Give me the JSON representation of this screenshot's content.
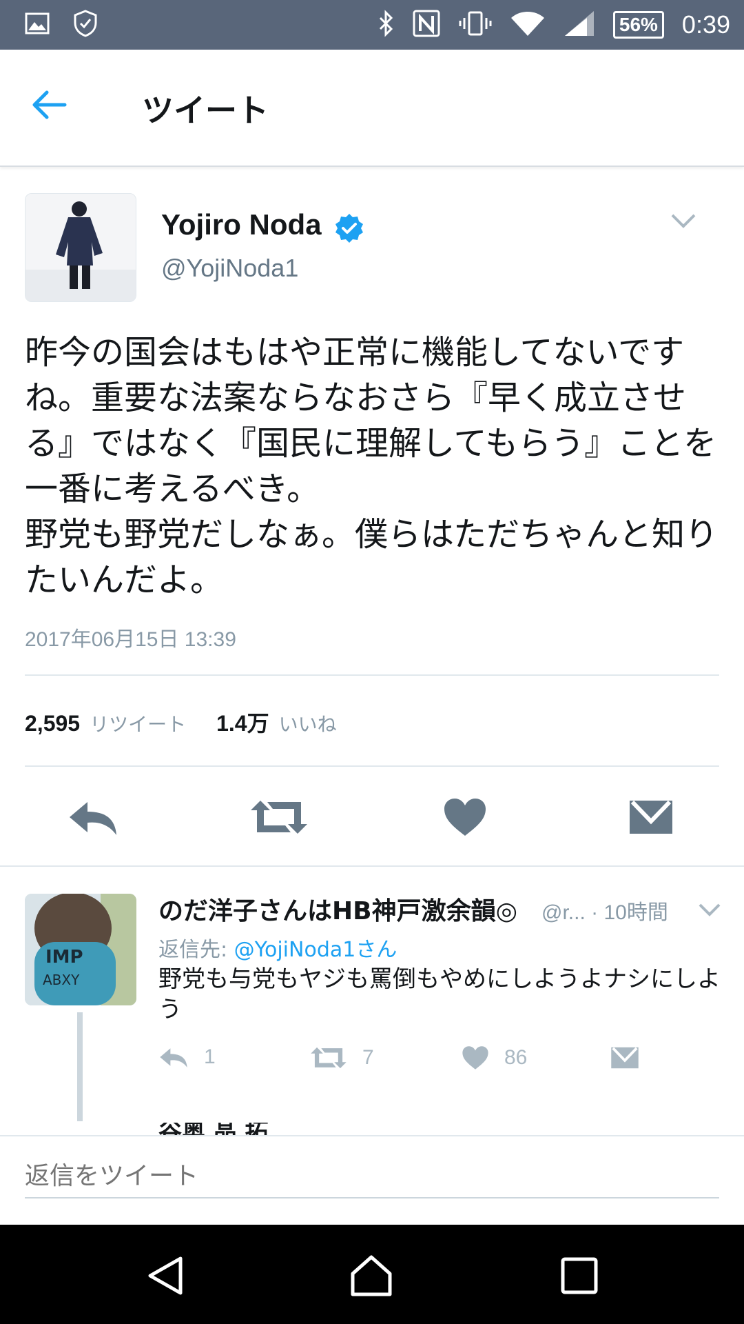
{
  "status_bar": {
    "battery": "56%",
    "time": "0:39",
    "icons": [
      "image-icon",
      "shield-icon",
      "bluetooth-icon",
      "nfc-icon",
      "vibrate-icon",
      "wifi-icon",
      "signal-icon"
    ]
  },
  "header": {
    "title": "ツイート"
  },
  "tweet": {
    "author_name": "Yojiro Noda",
    "author_handle": "@YojiNoda1",
    "text": "昨今の国会はもはや正常に機能してないですね。重要な法案ならなおさら『早く成立させる』ではなく『国民に理解してもらう』ことを一番に考えるべき。\n野党も野党だしなぁ。僕らはただちゃんと知りたいんだよ。",
    "timestamp": "2017年06月15日 13:39",
    "retweets_count": "2,595",
    "retweets_label": "リツイート",
    "likes_count": "1.4万",
    "likes_label": "いいね"
  },
  "reply": {
    "author_name": "のだ洋子さんはHB神戸激余韻◎",
    "handle_time": "@r... · 10時間",
    "reply_to_prefix": "返信先: ",
    "reply_to_link": "@YojiNoda1さん",
    "text": "野党も与党もヤジも罵倒もやめにしようよナシにしよう",
    "reply_count": "1",
    "retweet_count": "7",
    "like_count": "86"
  },
  "next_reply_peek": "谷奥 晶 拓",
  "compose": {
    "placeholder": "返信をツイート"
  },
  "colors": {
    "status_bar": "#59667a",
    "accent": "#1da1f2",
    "icon_gray": "#657786"
  }
}
